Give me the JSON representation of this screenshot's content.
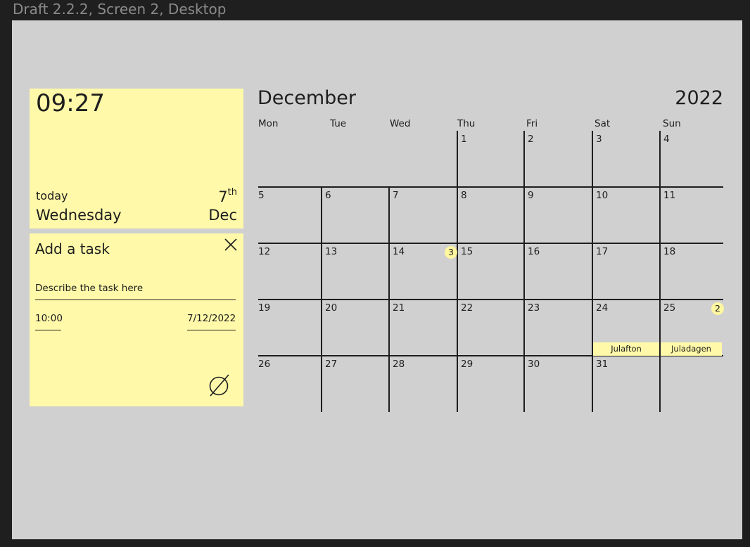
{
  "frame": {
    "title": "Draft 2.2.2, Screen 2, Desktop"
  },
  "clock": {
    "time": "09:27",
    "today_label": "today",
    "weekday": "Wednesday",
    "day_number": "7",
    "day_suffix": "th",
    "month_short": "Dec"
  },
  "task_form": {
    "title": "Add a task",
    "description_placeholder": "Describe the task here",
    "time_value": "10:00",
    "date_value": "7/12/2022",
    "close_icon": "close-icon",
    "submit_icon": "slashed-circle-icon"
  },
  "calendar": {
    "month": "December",
    "year": "2022",
    "weekdays": [
      "Mon",
      "Tue",
      "Wed",
      "Thu",
      "Fri",
      "Sat",
      "Sun"
    ],
    "weeks": [
      [
        "",
        "",
        "",
        "1",
        "2",
        "3",
        "4"
      ],
      [
        "5",
        "6",
        "7",
        "8",
        "9",
        "10",
        "11"
      ],
      [
        "12",
        "13",
        "14",
        "15",
        "16",
        "17",
        "18"
      ],
      [
        "19",
        "20",
        "21",
        "22",
        "23",
        "24",
        "25"
      ],
      [
        "26",
        "27",
        "28",
        "29",
        "30",
        "31",
        ""
      ]
    ],
    "task_badges": [
      {
        "day": "14",
        "count": "3"
      },
      {
        "day": "25",
        "count": "2"
      }
    ],
    "holidays": [
      {
        "day": "24",
        "label": "Julafton"
      },
      {
        "day": "25",
        "label": "Juladagen"
      }
    ]
  },
  "colors": {
    "background": "#1f1f1f",
    "canvas": "#d0d0d0",
    "sticky_yellow": "#fff9a9",
    "text": "#1e1e1e",
    "frame_title": "#8a8a8a"
  }
}
